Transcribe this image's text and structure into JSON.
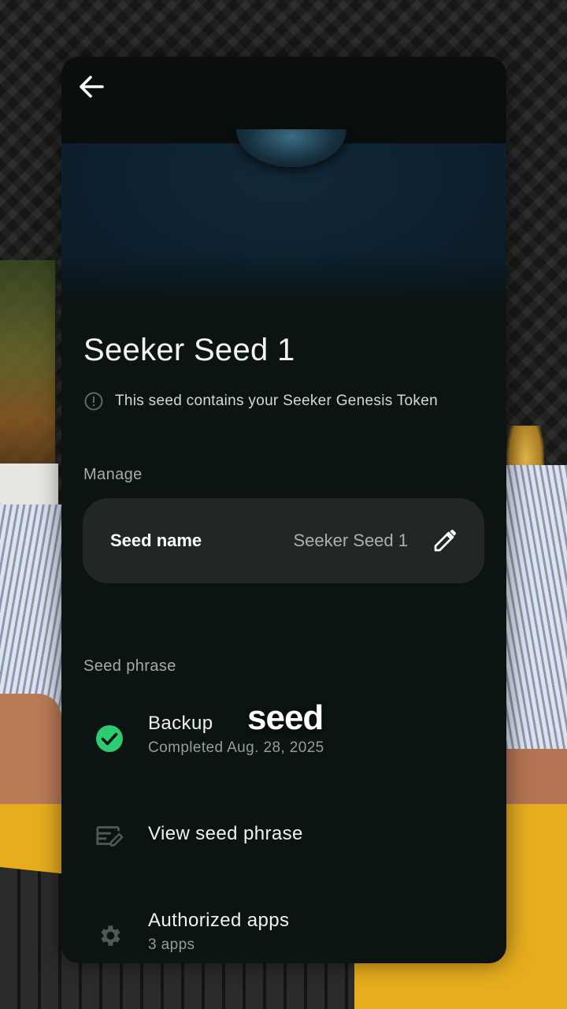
{
  "header": {
    "back_icon": "arrow-left-icon"
  },
  "seed": {
    "title": "Seeker Seed 1",
    "notice_icon": "info-circle-icon",
    "notice_text": "This seed contains your Seeker Genesis Token"
  },
  "manage": {
    "section_label": "Manage",
    "seed_name_label": "Seed name",
    "seed_name_value": "Seeker Seed 1",
    "edit_icon": "pencil-icon"
  },
  "seed_phrase": {
    "section_label": "Seed phrase",
    "items": [
      {
        "title": "Backup",
        "subtitle": "Completed Aug. 28, 2025",
        "icon": "check-circle-icon",
        "icon_color": "#2ecc71"
      },
      {
        "title": "View seed phrase",
        "icon": "edit-note-icon"
      },
      {
        "title": "Authorized apps",
        "subtitle": "3 apps",
        "icon": "gear-icon"
      }
    ]
  },
  "overlay_caption": "seed",
  "colors": {
    "card_bg": "#0b1412",
    "row_bg": "#222725",
    "accent_green": "#2ecc71"
  }
}
